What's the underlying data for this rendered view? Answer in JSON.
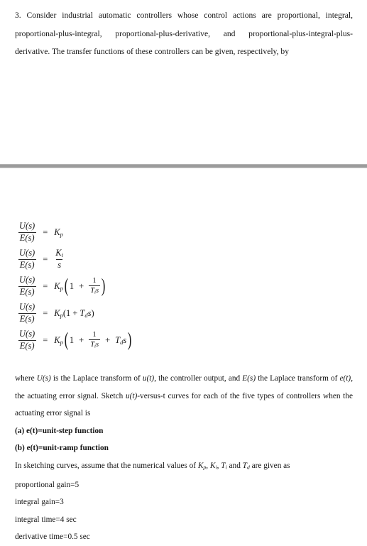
{
  "document": {
    "question_number": "3.",
    "intro_paragraph": "3. Consider industrial automatic controllers whose control actions are proportional, integral, proportional-plus-integral, proportional-plus-derivative, and proportional-plus-integral-plus-derivative. The transfer functions of these controllers can be given, respectively, by",
    "divider_color": "#9b9b9b",
    "background_color": "#ffffff",
    "text_color": "#141414"
  },
  "equations": {
    "lhs_numerator": "U(s)",
    "lhs_denominator": "E(s)",
    "equals": "=",
    "items": [
      {
        "id": "proportional",
        "rhs_text": "K_p"
      },
      {
        "id": "integral",
        "rhs_numerator": "K_i",
        "rhs_denominator": "s"
      },
      {
        "id": "proportional-plus-integral",
        "gain": "K_p",
        "one": "1",
        "plus": "+",
        "frac_num": "1",
        "frac_den": "T_i s"
      },
      {
        "id": "proportional-plus-derivative",
        "gain": "K_p",
        "one": "1",
        "plus": "+",
        "term": "T_d s"
      },
      {
        "id": "proportional-plus-integral-plus-derivative",
        "gain": "K_p",
        "one": "1",
        "plus": "+",
        "frac_num": "1",
        "frac_den": "T_i s",
        "plus2": "+",
        "term": "T_d s"
      }
    ],
    "symbols": {
      "U": "U",
      "E": "E",
      "s": "s",
      "K": "K",
      "T": "T",
      "sub_p": "p",
      "sub_i": "i",
      "sub_d": "d",
      "one": "1",
      "lparen": "(",
      "rparen": ")",
      "plus": "+"
    }
  },
  "body": {
    "where_paragraph": "where U(s) is the Laplace transform of u(t), the controller output, and E(s) the Laplace transform of e(t), the actuating error signal. Sketch u(t)-versus-t curves for each of the five types of controllers when the actuating error signal is",
    "where_parts": {
      "p1": "where ",
      "Us": "U(s)",
      "p2": " is the Laplace transform of ",
      "ut": "u(t)",
      "p3": ", the controller output, and ",
      "Es": "E(s)",
      "p4": " the Laplace transform of ",
      "et": "e(t)",
      "p5": ", the actuating error signal. Sketch ",
      "ut2": "u(t)",
      "p6": "-versus-t curves for each of the five types of controllers when the actuating error signal is"
    },
    "option_a": "(a) e(t)=unit-step function",
    "option_b": "(b) e(t)=unit-ramp function",
    "sketch_intro": {
      "p1": "In sketching curves, assume that the numerical values of ",
      "Kp": "Kp",
      "c1": ", ",
      "Ki": "Ki",
      "c2": ", ",
      "Ti": "Ti",
      "c3": " and ",
      "Td": "Td",
      "p2": " are given as"
    },
    "sketch_intro_text": "In sketching curves, assume that the numerical values of Kp, Ki, Ti and Td are given as",
    "values": [
      "proportional gain=5",
      "integral gain=3",
      "integral time=4 sec",
      "derivative time=0.5 sec"
    ]
  }
}
